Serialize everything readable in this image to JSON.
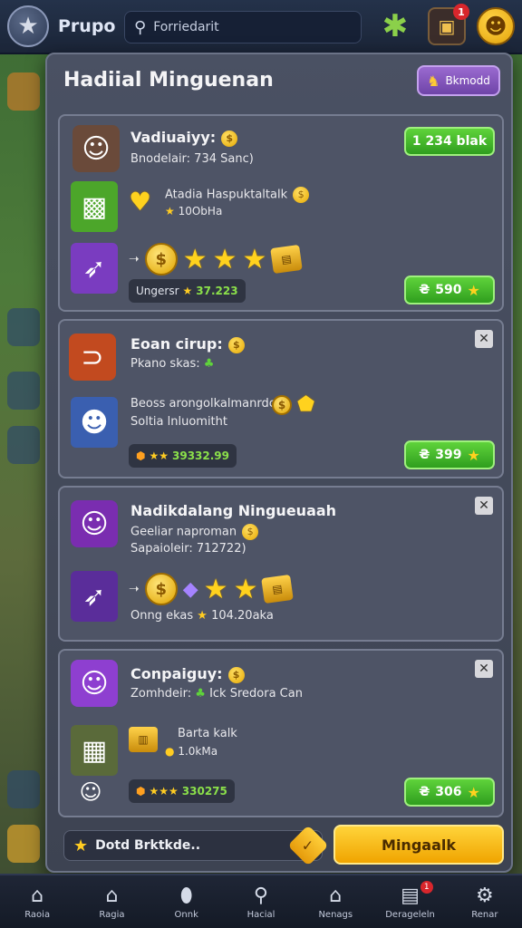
{
  "topbar": {
    "group_label": "Prupo",
    "search_placeholder": "Forriedarit",
    "inbox_badge": "1"
  },
  "modal": {
    "title": "Hadiial Minguenan",
    "premium_label": "Bkmodd"
  },
  "cards": [
    {
      "title": "Vadiuaiyy:",
      "subtitle": "Bnodelair: 734 Sanc)",
      "reward_title": "Atadia Haspuktaltalk",
      "reward_sub": "10ObHa",
      "progress_label": "Ungersr",
      "progress_value": "37.223",
      "top_button": "1 234 blak",
      "bottom_button": "590"
    },
    {
      "title": "Eoan cirup:",
      "subtitle": "Pkano skas:",
      "line1": "Beoss arongolkalmanrdc",
      "line2": "Soltia lnluomitht",
      "progress_value": "39332.99",
      "bottom_button": "399"
    },
    {
      "title": "Nadikdalang Ningueuaah",
      "subtitle": "Geeliar naproman",
      "line2": "Sapaioleir: 712722)",
      "progress_label": "Onng ekas",
      "progress_value": "104.20aka"
    },
    {
      "title": "Conpaiguy:",
      "subtitle": "Zomhdeir:",
      "subtitle_b": "Ick Sredora Can",
      "reward_title": "Barta kalk",
      "reward_sub": "1.0kMa",
      "progress_value": "330275",
      "bottom_button": "306"
    }
  ],
  "footer": {
    "field_placeholder": "Dotd Brktkde..",
    "cta_label": "Mingaalk"
  },
  "nav": [
    {
      "label": "Raoia",
      "icon": "home-icon"
    },
    {
      "label": "Ragia",
      "icon": "house-gear-icon"
    },
    {
      "label": "Onnk",
      "icon": "pin-icon"
    },
    {
      "label": "Hacial",
      "icon": "search-icon"
    },
    {
      "label": "Nenags",
      "icon": "shop-icon"
    },
    {
      "label": "Derageleln",
      "icon": "inbox-icon",
      "badge": "1"
    },
    {
      "label": "Renar",
      "icon": "gear-icon"
    }
  ]
}
